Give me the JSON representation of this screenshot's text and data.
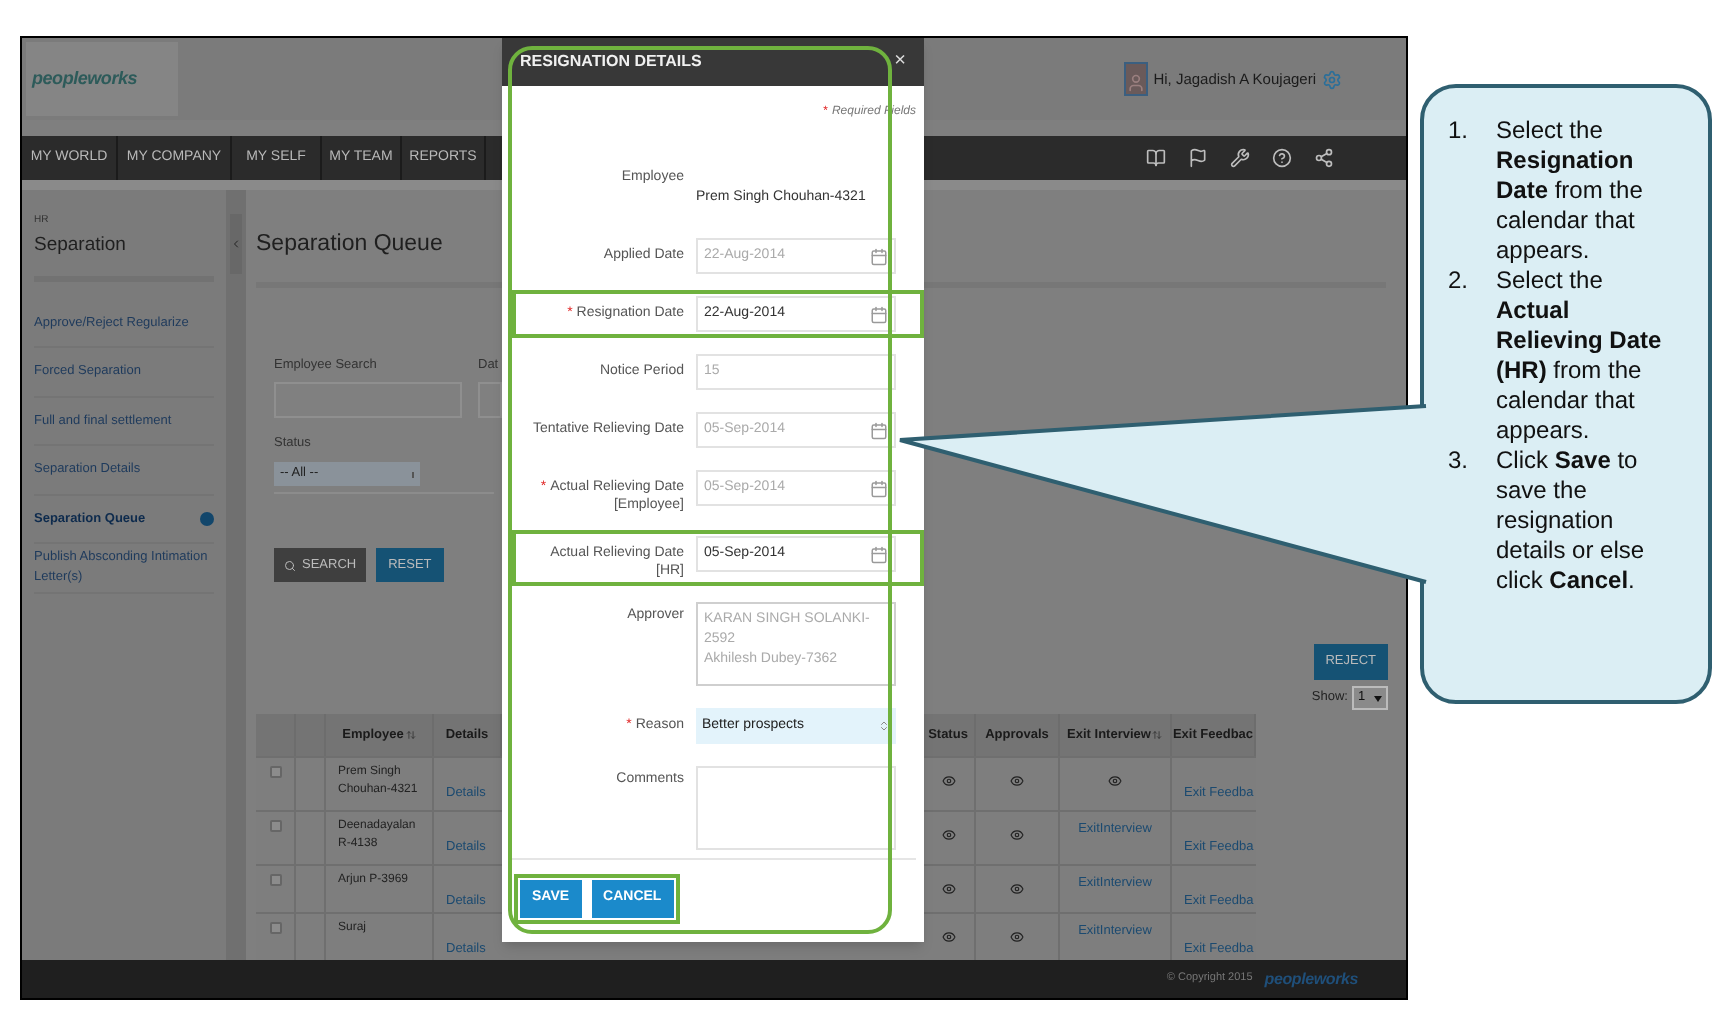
{
  "header": {
    "logo": "peopleworks",
    "greeting": "Hi, Jagadish A Koujageri"
  },
  "nav": {
    "items": [
      "MY WORLD",
      "MY COMPANY",
      "MY SELF",
      "MY TEAM",
      "REPORTS"
    ]
  },
  "sidebar": {
    "section": "HR",
    "title": "Separation",
    "items": [
      {
        "label": "Approve/Reject Regularize",
        "selected": false
      },
      {
        "label": "Forced Separation",
        "selected": false
      },
      {
        "label": "Full and final settlement",
        "selected": false
      },
      {
        "label": "Separation Details",
        "selected": false
      },
      {
        "label": "Separation Queue",
        "selected": true
      },
      {
        "label": "Publish Absconding Intimation Letter(s)",
        "selected": false
      }
    ]
  },
  "page": {
    "title": "Separation Queue",
    "employee_search_label": "Employee Search",
    "date_label": "Dat",
    "status_label": "Status",
    "status_value": "-- All --",
    "search_button": "SEARCH",
    "reset_button": "RESET",
    "reject_button": "REJECT",
    "show_label": "Show:",
    "show_value": "1"
  },
  "table": {
    "columns": [
      {
        "label": "Employee",
        "sortable": true
      },
      {
        "label": "Details",
        "sortable": false
      },
      {
        "label": "Status",
        "sortable": false
      },
      {
        "label": "Approvals",
        "sortable": false
      },
      {
        "label": "Exit Interview",
        "sortable": true
      },
      {
        "label": "Exit Feedbac",
        "sortable": false
      }
    ],
    "rows": [
      {
        "checked": false,
        "employee": "Prem Singh Chouhan-4321",
        "details": "Details",
        "exit_interview": {
          "kind": "icon"
        },
        "exit_feedback": "Exit Feedba"
      },
      {
        "checked": false,
        "employee": "Deenadayalan R-4138",
        "details": "Details",
        "exit_interview": {
          "kind": "link",
          "label": "ExitInterview"
        },
        "exit_feedback": "Exit Feedba"
      },
      {
        "checked": false,
        "employee": "Arjun P-3969",
        "details": "Details",
        "exit_interview": {
          "kind": "link",
          "label": "ExitInterview"
        },
        "exit_feedback": "Exit Feedba"
      },
      {
        "checked": false,
        "employee": "Suraj",
        "details": "Details",
        "exit_interview": {
          "kind": "link",
          "label": "ExitInterview"
        },
        "exit_feedback": "Exit Feedba"
      }
    ]
  },
  "footer": {
    "copyright": "© Copyright 2015",
    "logo": "peopleworks"
  },
  "dialog": {
    "title": "RESIGNATION DETAILS",
    "close": "×",
    "required_mark": "*",
    "required_note": "Required Fields",
    "highlighted": true,
    "fields": [
      {
        "label": "Employee",
        "kind": "text",
        "value": "Prem Singh Chouhan-4321",
        "required": false,
        "disabled": false,
        "highlighted": false
      },
      {
        "label": "Applied Date",
        "kind": "date",
        "value": "22-Aug-2014",
        "required": false,
        "disabled": true,
        "highlighted": false
      },
      {
        "label": "Resignation Date",
        "kind": "date",
        "value": "22-Aug-2014",
        "required": true,
        "disabled": false,
        "highlighted": true
      },
      {
        "label": "Notice Period",
        "kind": "input",
        "value": "15",
        "required": false,
        "disabled": true,
        "highlighted": false
      },
      {
        "label": "Tentative Relieving Date",
        "kind": "date",
        "value": "05-Sep-2014",
        "required": false,
        "disabled": true,
        "highlighted": false
      },
      {
        "label": "Actual Relieving Date [Employee]",
        "kind": "date",
        "value": "05-Sep-2014",
        "required": true,
        "disabled": true,
        "highlighted": false
      },
      {
        "label": "Actual Relieving Date [HR]",
        "kind": "date",
        "value": "05-Sep-2014",
        "required": false,
        "disabled": false,
        "highlighted": true
      },
      {
        "label": "Approver",
        "kind": "textarea",
        "lines": [
          "KARAN SINGH SOLANKI-2592",
          "Akhilesh Dubey-7362"
        ],
        "required": false,
        "disabled": true,
        "highlighted": false
      },
      {
        "label": "Reason",
        "kind": "select",
        "value": "Better prospects",
        "required": true,
        "disabled": false,
        "highlighted": false
      },
      {
        "label": "Comments",
        "kind": "textarea",
        "required": false,
        "disabled": false,
        "highlighted": false
      }
    ],
    "actions_highlighted": true,
    "buttons": [
      "SAVE",
      "CANCEL"
    ]
  },
  "callout": {
    "steps": [
      {
        "number": "1.",
        "text": "Select the **Resignation Date** from the calendar that appears."
      },
      {
        "number": "2.",
        "text": "Select the **Actual Relieving Date (HR)** from the calendar that appears."
      },
      {
        "number": "3.",
        "text": "Click **Save** to save the resignation details or else click **Cancel**."
      }
    ]
  }
}
